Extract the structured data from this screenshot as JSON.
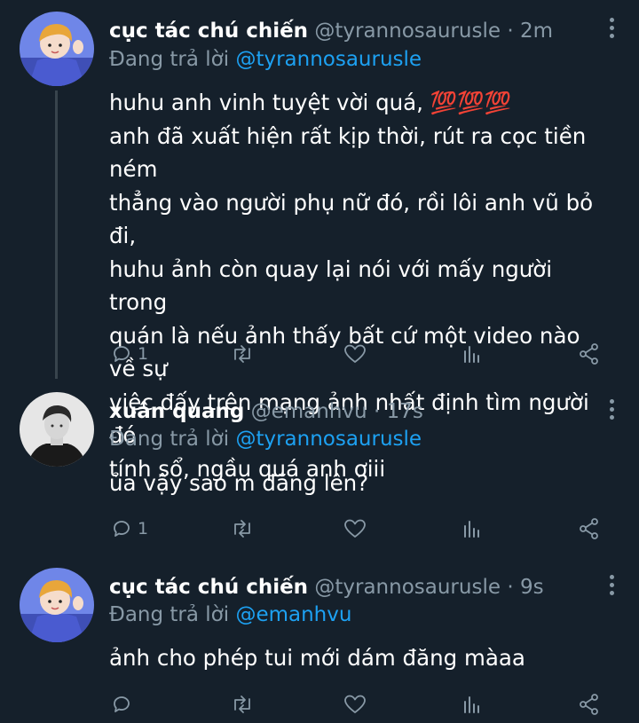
{
  "tweets": [
    {
      "name": "cục tác chú chiến",
      "handle": "@tyrannosaurusle",
      "sep": "·",
      "time": "2m",
      "reply_prefix": "Đang trả lời",
      "reply_to": "@tyrannosaurusle",
      "lines": [
        "huhu anh vinh tuyệt vời quá, 💯💯💯",
        "anh đã xuất hiện rất kịp thời, rút ra cọc tiền ném",
        "thẳng vào người phụ nữ đó, rồi lôi anh vũ bỏ đi,",
        "huhu ảnh còn quay lại nói với mấy người trong",
        "quán là nếu ảnh thấy bất cứ một video nào về sự",
        "việc đấy trên mạng ảnh nhất định tìm người đó",
        "tính sổ, ngầu quá anh ơiii"
      ],
      "reply_count": "1",
      "avatar_icon": "cartoon-avatar"
    },
    {
      "name": "xuân quang",
      "handle": "@emanhvu",
      "sep": "·",
      "time": "17s",
      "reply_prefix": "Đang trả lời",
      "reply_to": "@tyrannosaurusle",
      "lines": [
        "ủa vậy sao m đăng lên?"
      ],
      "reply_count": "1",
      "avatar_icon": "photo-avatar"
    },
    {
      "name": "cục tác chú chiến",
      "handle": "@tyrannosaurusle",
      "sep": "·",
      "time": "9s",
      "reply_prefix": "Đang trả lời",
      "reply_to": "@emanhvu",
      "lines": [
        "ảnh cho phép tui mới dám đăng màaa"
      ],
      "reply_count": "",
      "avatar_icon": "cartoon-avatar"
    }
  ],
  "icons": {
    "reply": "reply-icon",
    "retweet": "retweet-icon",
    "like": "heart-icon",
    "analytics": "analytics-icon",
    "share": "share-icon",
    "more": "more-vertical-icon"
  },
  "colors": {
    "background": "#15202b",
    "text": "#ffffff",
    "muted": "#8899a6",
    "link": "#1da1f2",
    "thread_line": "#38444d"
  }
}
